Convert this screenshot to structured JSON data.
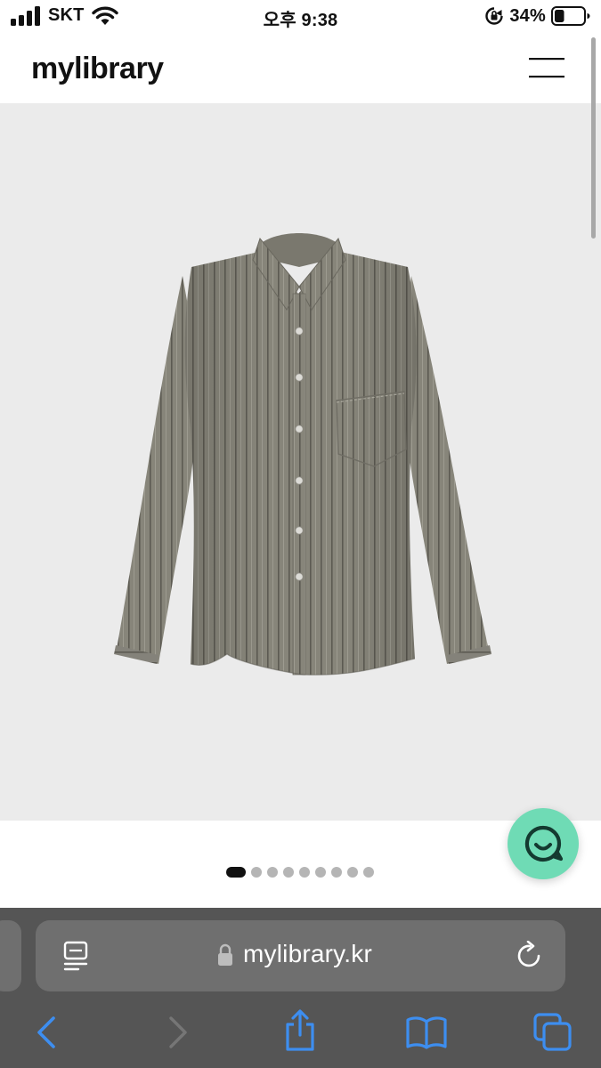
{
  "status_bar": {
    "carrier": "SKT",
    "time": "오후 9:38",
    "battery_percent": "34%",
    "battery_level": 0.34,
    "icons": [
      "signal-icon",
      "wifi-icon",
      "orientation-lock-icon",
      "battery-icon"
    ]
  },
  "header": {
    "logo_text": "mylibrary",
    "menu_icon": "hamburger-menu-icon"
  },
  "hero": {
    "product_image": "grey-pinstripe-button-shirt",
    "background_color": "#ebebeb"
  },
  "carousel": {
    "total_pages": 9,
    "current_page": 1
  },
  "chat": {
    "icon": "chat-smile-icon",
    "color": "#6fdbb5"
  },
  "browser": {
    "url": "mylibrary.kr",
    "icons": {
      "reader": "reader-mode-icon",
      "lock": "lock-icon",
      "reload": "reload-icon",
      "back": "back-arrow-icon",
      "forward": "forward-arrow-icon",
      "share": "share-icon",
      "bookmarks": "bookmarks-icon",
      "tabs": "tabs-icon"
    },
    "accent": "#3d8ef0"
  }
}
